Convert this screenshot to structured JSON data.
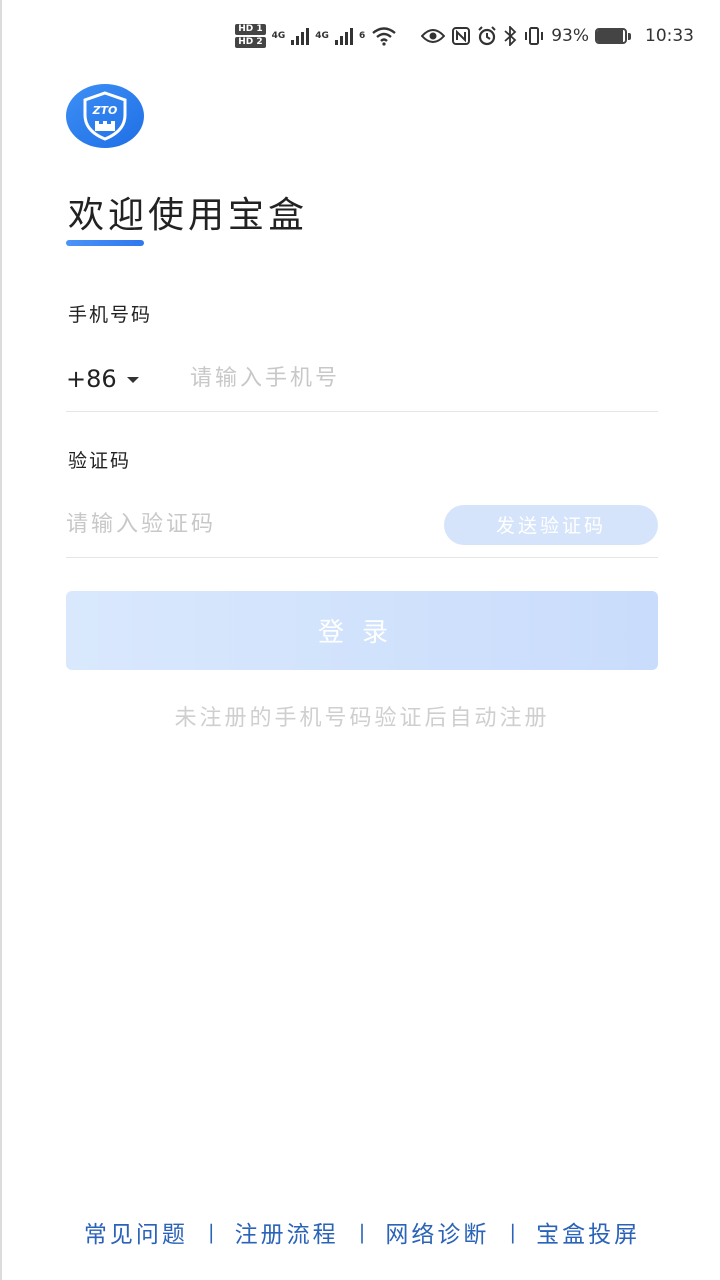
{
  "status_bar": {
    "sim1": "HD 1",
    "sim2": "HD 2",
    "net1": "4G",
    "net2": "4G",
    "wifi_gen": "6",
    "battery": "93%",
    "battery_level": 0.93,
    "time": "10:33"
  },
  "logo": {
    "text": "ZTO"
  },
  "title": "欢迎使用宝盒",
  "phone": {
    "label": "手机号码",
    "country_code": "+86",
    "placeholder": "请输入手机号"
  },
  "code": {
    "label": "验证码",
    "placeholder": "请输入验证码",
    "send_label": "发送验证码"
  },
  "login_label": "登录",
  "hint": "未注册的手机号码验证后自动注册",
  "footer": {
    "links": [
      "常见问题",
      "注册流程",
      "网络诊断",
      "宝盒投屏"
    ],
    "separator": "|"
  },
  "colors": {
    "accent": "#2f78ee",
    "link": "#2a63b8",
    "disabled_button": "#d5e4fb"
  }
}
